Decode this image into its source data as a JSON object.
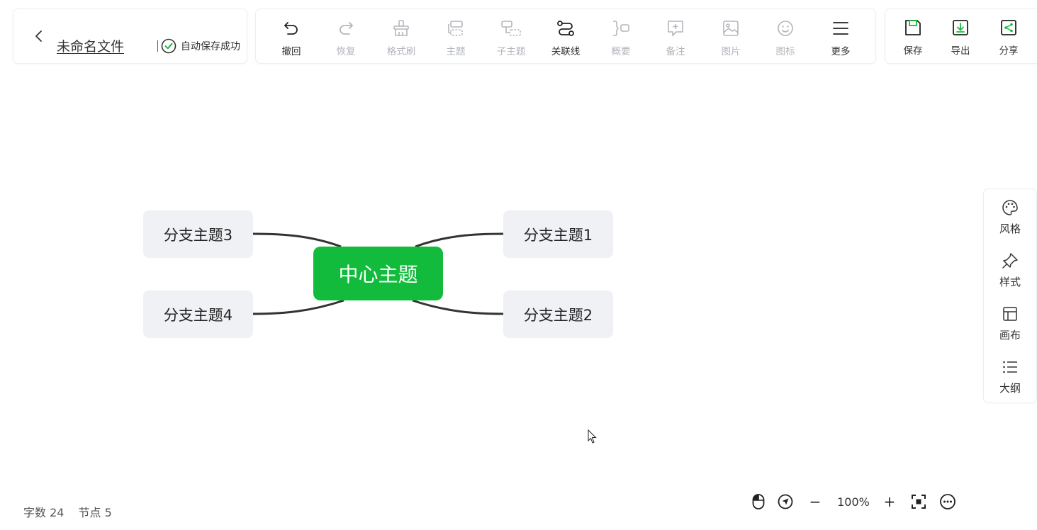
{
  "file": {
    "title": "未命名文件",
    "save_status": "自动保存成功",
    "save_status_color": "#13bb3c"
  },
  "toolbar": {
    "tools": [
      {
        "label": "撤回",
        "icon": "undo-icon",
        "enabled": true
      },
      {
        "label": "恢复",
        "icon": "redo-icon",
        "enabled": false
      },
      {
        "label": "格式刷",
        "icon": "format-brush-icon",
        "enabled": false
      },
      {
        "label": "主题",
        "icon": "topic-icon",
        "enabled": false
      },
      {
        "label": "子主题",
        "icon": "subtopic-icon",
        "enabled": false
      },
      {
        "label": "关联线",
        "icon": "relation-line-icon",
        "enabled": true
      },
      {
        "label": "概要",
        "icon": "summary-icon",
        "enabled": false
      },
      {
        "label": "备注",
        "icon": "note-icon",
        "enabled": false
      },
      {
        "label": "图片",
        "icon": "image-icon",
        "enabled": false
      },
      {
        "label": "图标",
        "icon": "emoji-icon",
        "enabled": false
      },
      {
        "label": "更多",
        "icon": "menu-icon",
        "enabled": true
      }
    ]
  },
  "actions": {
    "save": "保存",
    "export": "导出",
    "share": "分享",
    "accent_color": "#13bb3c"
  },
  "side_panel": {
    "items": [
      {
        "label": "风格",
        "icon": "palette-icon"
      },
      {
        "label": "样式",
        "icon": "style-pin-icon"
      },
      {
        "label": "画布",
        "icon": "layout-icon"
      },
      {
        "label": "大纲",
        "icon": "outline-list-icon"
      }
    ]
  },
  "mindmap": {
    "central": "中心主题",
    "central_color": "#13bb3c",
    "branches": [
      "分支主题1",
      "分支主题2",
      "分支主题3",
      "分支主题4"
    ]
  },
  "status": {
    "word_count_label": "字数",
    "word_count": "24",
    "node_count_label": "节点",
    "node_count": "5",
    "zoom": "100%",
    "zoom_out": "−",
    "zoom_in": "+"
  }
}
